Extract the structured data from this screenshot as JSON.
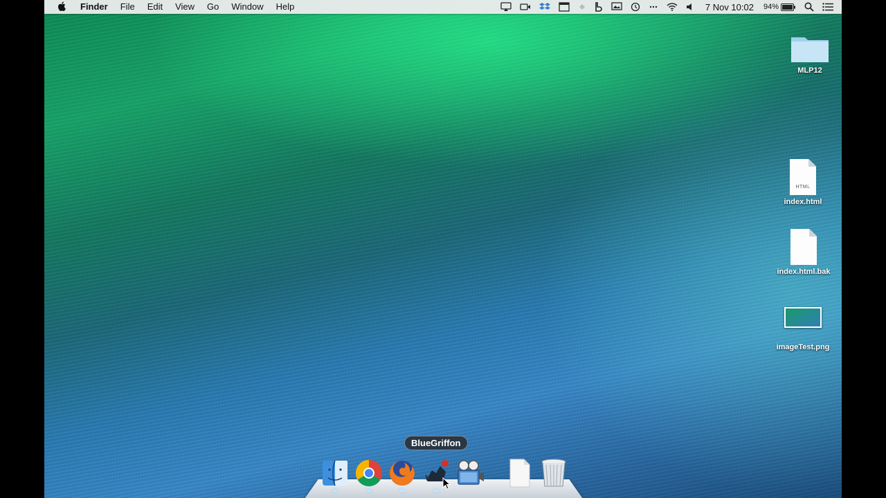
{
  "menubar": {
    "apple": "",
    "app_name": "Finder",
    "menus": [
      "File",
      "Edit",
      "View",
      "Go",
      "Window",
      "Help"
    ],
    "clock": "7 Nov  10:02",
    "battery": "94%"
  },
  "desktop": {
    "icons": [
      {
        "label": "MLP12",
        "icon": "folder-icon"
      },
      {
        "label": "index.html",
        "icon": "html-file-icon",
        "tag": "HTML"
      },
      {
        "label": "index.html.bak",
        "icon": "file-icon"
      },
      {
        "label": "imageTest.png",
        "icon": "image-file-icon"
      }
    ]
  },
  "dock": {
    "tooltip": "BlueGriffon",
    "items": [
      "finder-icon",
      "chrome-icon",
      "firefox-icon",
      "bluegriffon-icon",
      "image-capture-icon",
      "document-stack-icon",
      "trash-icon"
    ]
  },
  "colors": {
    "menubar": "#ececec",
    "accent": "#1aa26a"
  }
}
